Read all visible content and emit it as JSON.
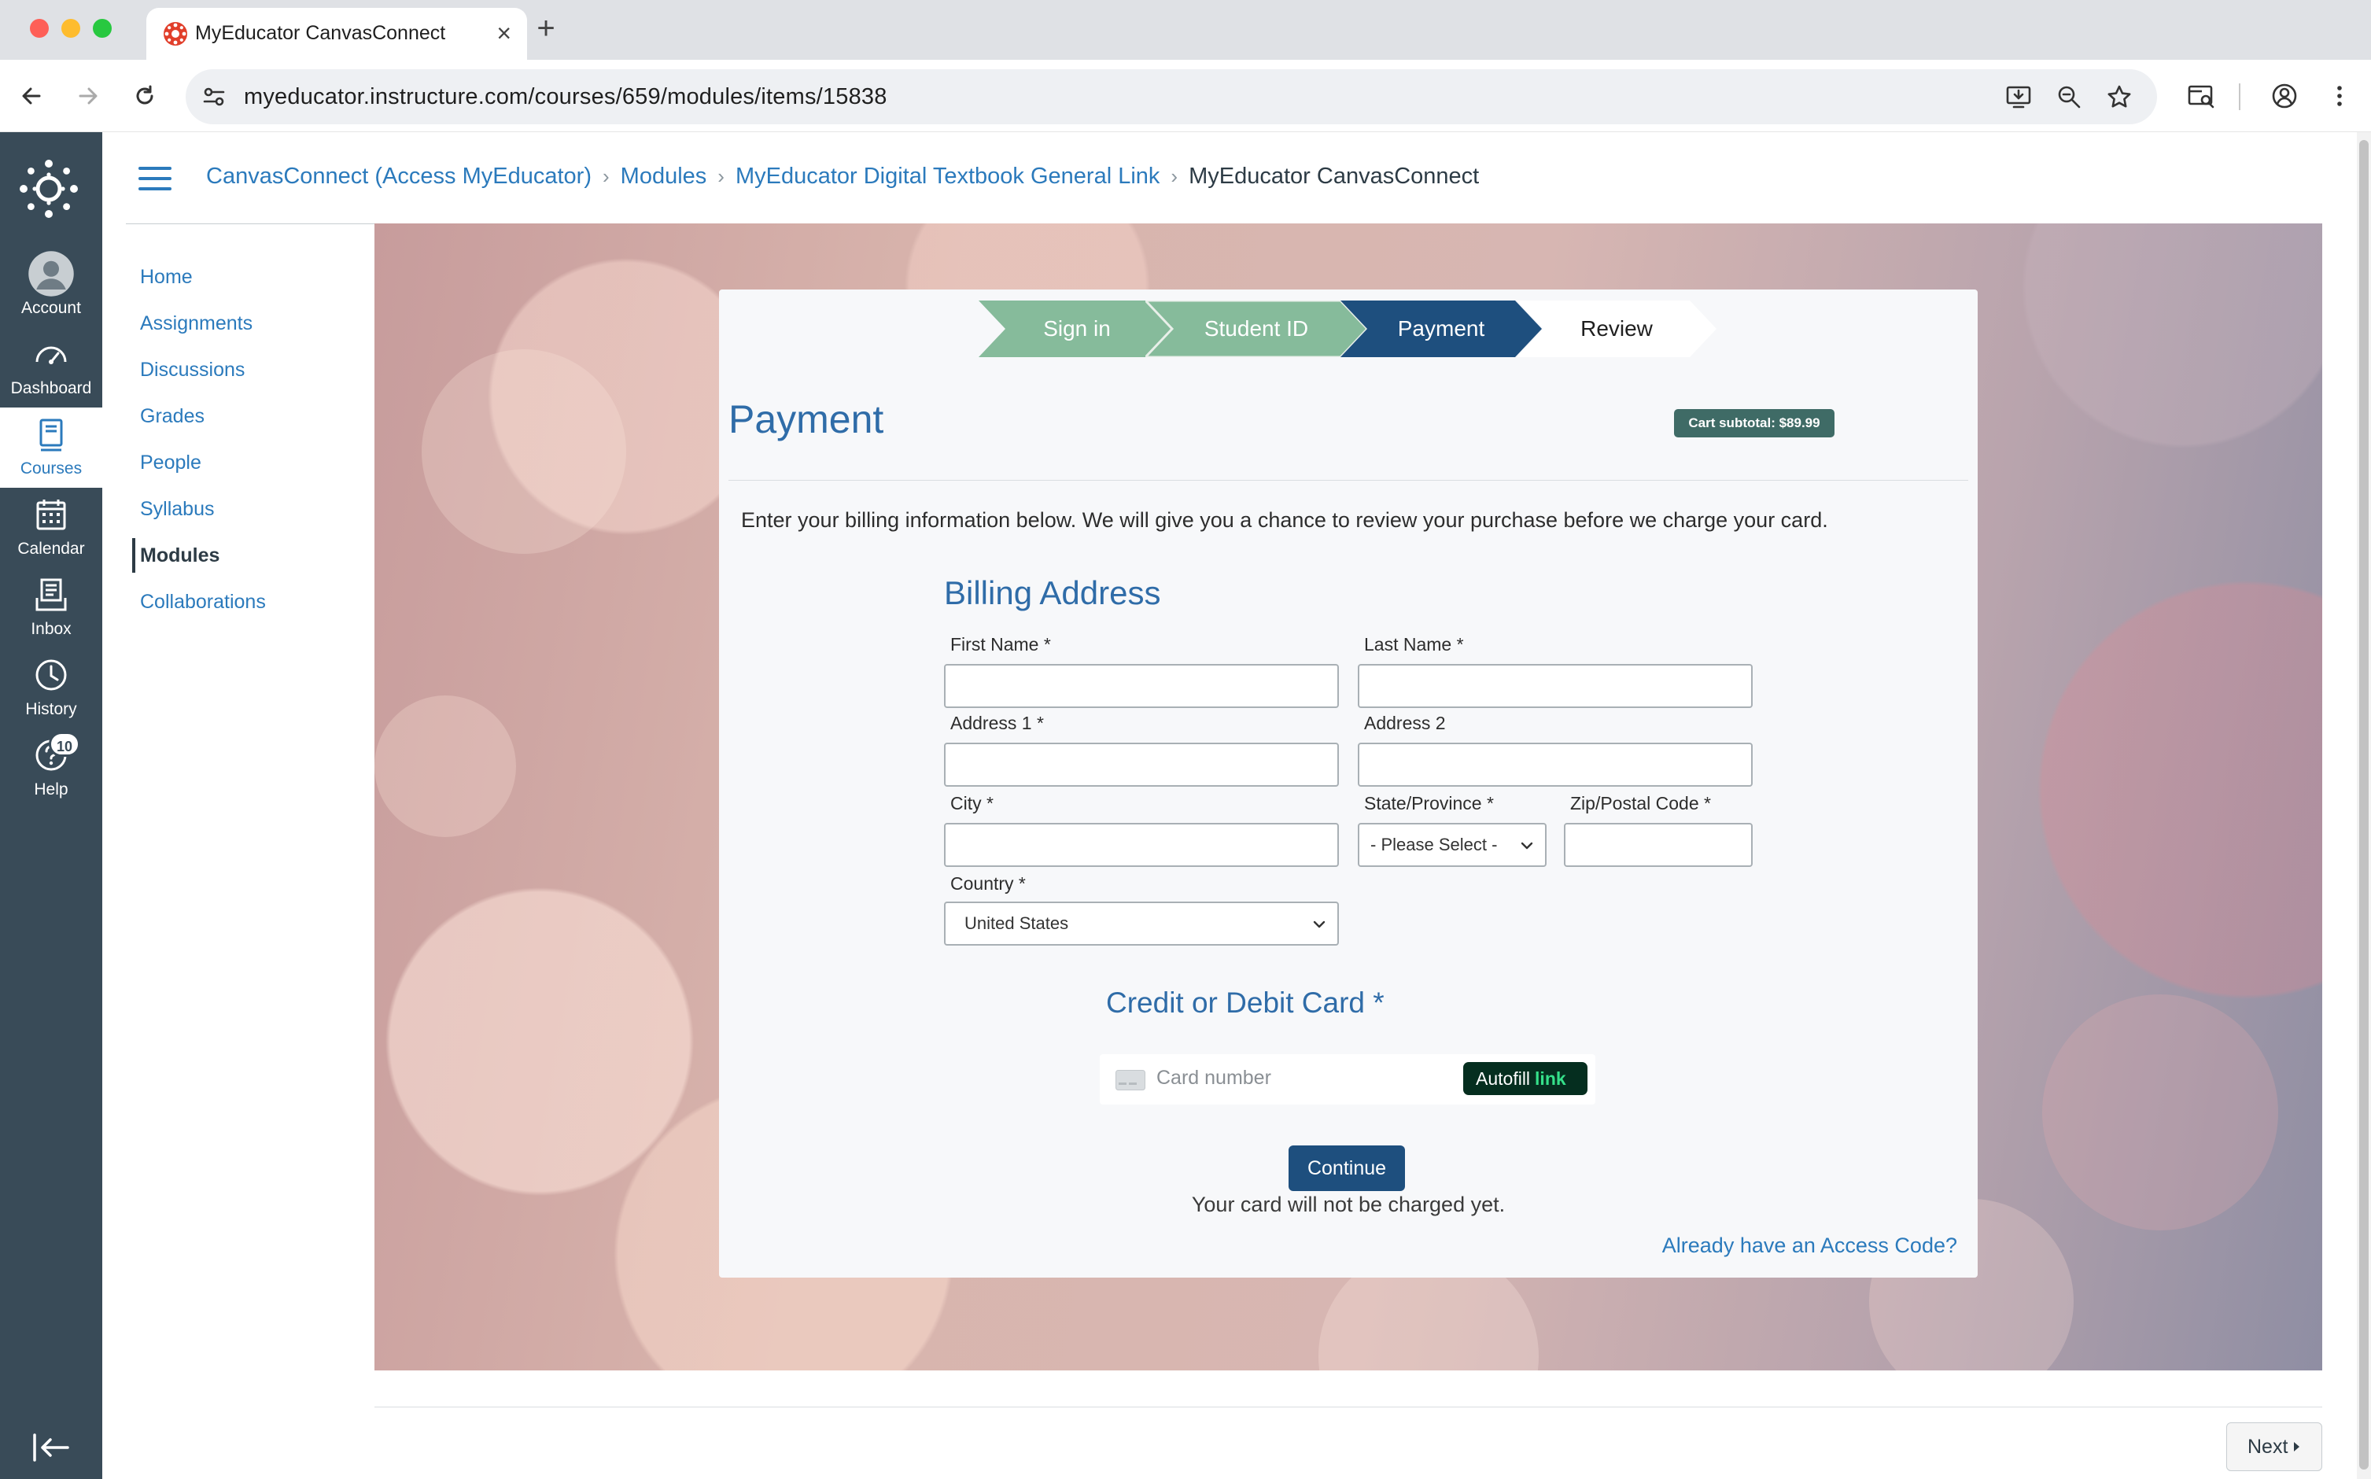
{
  "browser": {
    "tab_title": "MyEducator CanvasConnect",
    "url": "myeducator.instructure.com/courses/659/modules/items/15838"
  },
  "global_nav": {
    "items": [
      {
        "label": "Account",
        "icon": "account-avatar-icon"
      },
      {
        "label": "Dashboard",
        "icon": "dashboard-gauge-icon"
      },
      {
        "label": "Courses",
        "icon": "courses-book-icon",
        "active": true
      },
      {
        "label": "Calendar",
        "icon": "calendar-icon"
      },
      {
        "label": "Inbox",
        "icon": "inbox-icon"
      },
      {
        "label": "History",
        "icon": "history-clock-icon"
      },
      {
        "label": "Help",
        "icon": "help-icon",
        "badge": "10"
      }
    ]
  },
  "breadcrumb": {
    "items": [
      "CanvasConnect (Access MyEducator)",
      "Modules",
      "MyEducator Digital Textbook General Link"
    ],
    "current": "MyEducator CanvasConnect"
  },
  "course_nav": {
    "items": [
      "Home",
      "Assignments",
      "Discussions",
      "Grades",
      "People",
      "Syllabus",
      "Modules",
      "Collaborations"
    ],
    "active": "Modules"
  },
  "checkout": {
    "steps": [
      "Sign in",
      "Student ID",
      "Payment",
      "Review"
    ],
    "title": "Payment",
    "cart_subtotal": "Cart subtotal: $89.99",
    "intro": "Enter your billing information below. We will give you a chance to review your purchase before we charge your card.",
    "billing_title": "Billing Address",
    "fields": {
      "first_name": "First Name *",
      "last_name": "Last Name *",
      "address1": "Address 1 *",
      "address2": "Address 2",
      "city": "City *",
      "state": "State/Province *",
      "zip": "Zip/Postal Code *",
      "country": "Country *"
    },
    "state_value": "- Please Select -",
    "country_value": "United States",
    "card_title": "Credit or Debit Card *",
    "card_placeholder": "Card number",
    "autofill_label": "Autofill",
    "autofill_link": "link",
    "continue_label": "Continue",
    "no_charge_note": "Your card will not be charged yet.",
    "access_code_link": "Already have an Access Code?"
  },
  "footer": {
    "next_label": "Next"
  },
  "colors": {
    "canvas_nav": "#394b58",
    "link_blue": "#2b7abc",
    "step_done": "#86bb9b",
    "step_active": "#1e4f7e",
    "cart_badge": "#3f6b66"
  }
}
